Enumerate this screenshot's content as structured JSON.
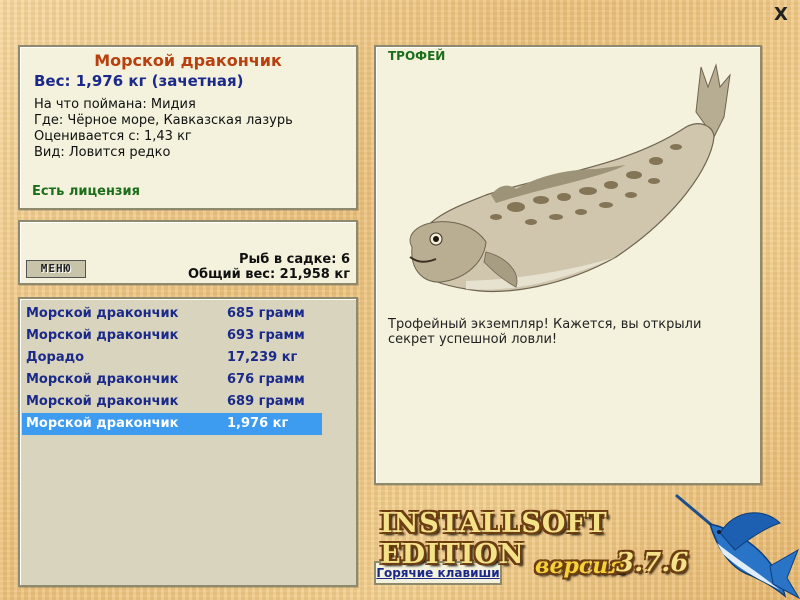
{
  "window": {
    "close_label": "X"
  },
  "fish_info": {
    "name": "Морской дракончик",
    "weight": "Вес: 1,976 кг (зачетная)",
    "bait": "На что поймана: Мидия",
    "location": "Где: Чёрное море, Кавказская лазурь",
    "rated_from": "Оценивается с: 1,43 кг",
    "kind": "Вид: Ловится редко",
    "license": "Есть лицензия"
  },
  "cage": {
    "menu_label": "МЕНЮ",
    "count": "Рыб в садке: 6",
    "total_weight": "Общий вес: 21,958 кг"
  },
  "catch_list": [
    {
      "name": "Морской дракончик",
      "weight": "685 грамм",
      "selected": false
    },
    {
      "name": "Морской дракончик",
      "weight": "693 грамм",
      "selected": false
    },
    {
      "name": "Дорадо",
      "weight": "17,239 кг",
      "selected": false
    },
    {
      "name": "Морской дракончик",
      "weight": "676 грамм",
      "selected": false
    },
    {
      "name": "Морской дракончик",
      "weight": "689 грамм",
      "selected": false
    },
    {
      "name": "Морской дракончик",
      "weight": "1,976 кг",
      "selected": true
    }
  ],
  "trophy": {
    "label": "ТРОФЕЙ",
    "message": "Трофейный экземпляр! Кажется, вы открыли секрет успешной ловли!"
  },
  "footer": {
    "hotkeys_label": "Горячие клавиши",
    "edition": "INSTALLSOFT EDITION",
    "version_word": "версия",
    "version_number": "3.7.6"
  },
  "colors": {
    "panel_bg": "#f4f1dc",
    "title_orange": "#b8400f",
    "text_navy": "#1b2a8a",
    "license_green": "#1c6e1a",
    "selection_blue": "#3d9cf0"
  },
  "icons": {
    "close": "close-icon",
    "fish": "weever-fish-image",
    "logo": "marlin-logo"
  }
}
